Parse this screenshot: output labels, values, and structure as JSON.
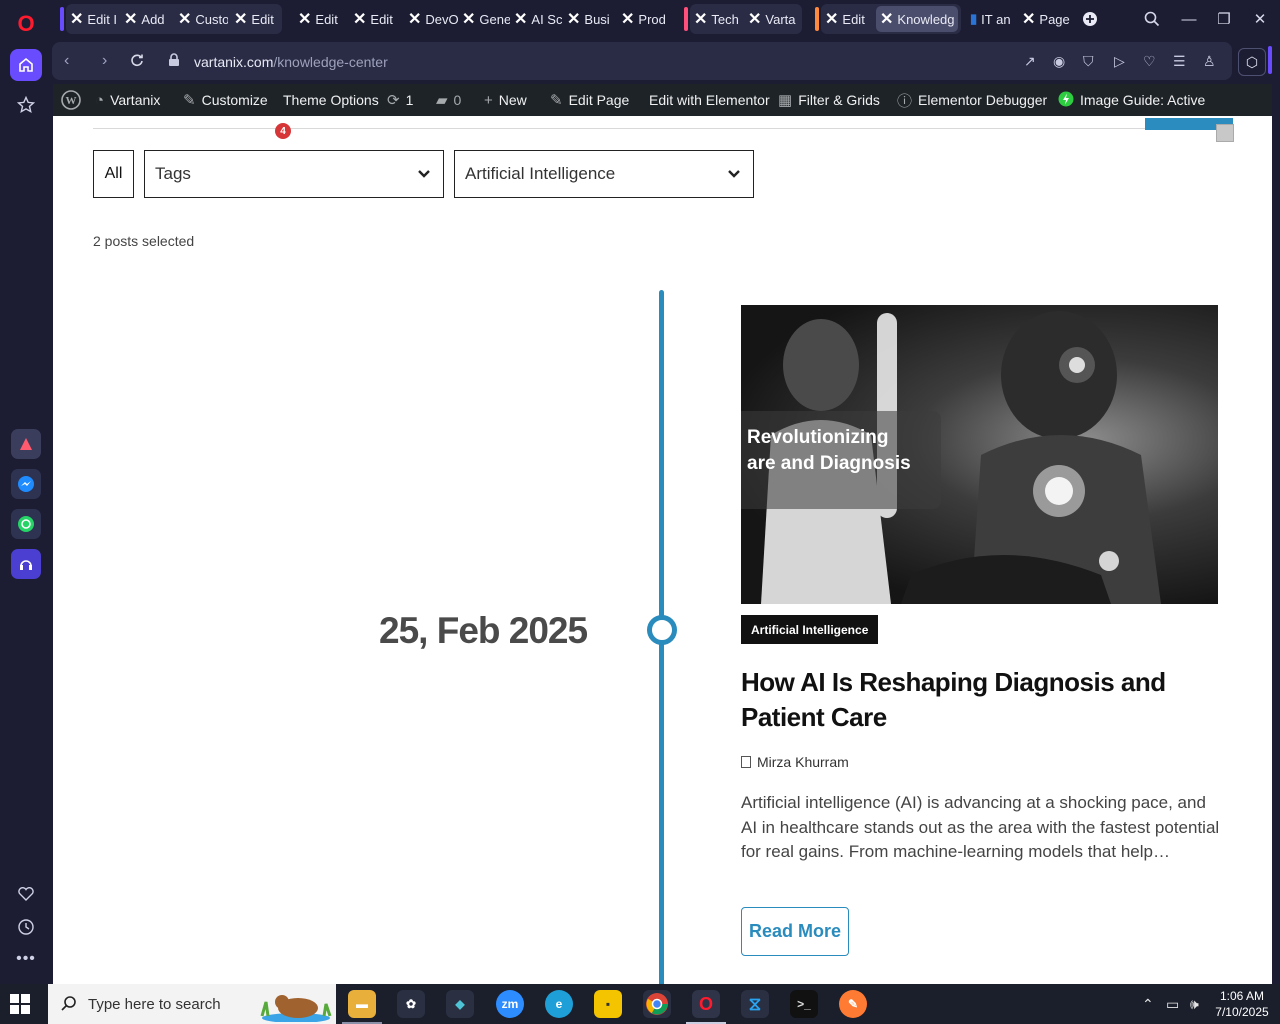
{
  "browser": {
    "tabs": [
      {
        "label": "Edit I"
      },
      {
        "label": "Add"
      },
      {
        "label": "Custo"
      },
      {
        "label": "Edit"
      },
      {
        "label": "Edit"
      },
      {
        "label": "Edit"
      },
      {
        "label": "DevO"
      },
      {
        "label": "Gene"
      },
      {
        "label": "AI Sc"
      },
      {
        "label": "Busi"
      },
      {
        "label": "Prod"
      },
      {
        "label": "Tech"
      },
      {
        "label": "Varta"
      },
      {
        "label": "Edit"
      },
      {
        "label": "Knowledg"
      },
      {
        "label": "IT an"
      },
      {
        "label": "Page"
      }
    ],
    "new_tab_icon": "plus-icon",
    "url_host": "vartanix.com",
    "url_path": "/knowledge-center",
    "group_colors": {
      "purple": "#6a4cff",
      "pink": "#ff4f7a",
      "orange": "#ff8a3d"
    }
  },
  "wpbar": {
    "site_name": "Vartanix",
    "customize": "Customize",
    "theme_options": "Theme Options",
    "updates_count": "1",
    "comments_count": "0",
    "new": "New",
    "edit_page": "Edit Page",
    "edit_elementor": "Edit with Elementor",
    "filter_grids": "Filter & Grids",
    "elementor_debugger": "Elementor Debugger",
    "image_guide": "Image Guide: Active"
  },
  "page": {
    "notification_count": "4",
    "filters": {
      "all_label": "All",
      "tags_placeholder": "Tags",
      "category_selected": "Artificial Intelligence"
    },
    "posts_selected": "2 posts selected",
    "post": {
      "date": "25, Feb 2025",
      "image_caption": "Revolutionizing\nare and Diagnosis",
      "category": "Artificial Intelligence",
      "title": "How AI Is Reshaping Diagnosis and Patient Care",
      "author": "Mirza Khurram",
      "excerpt": "Artificial intelligence (AI) is advancing at a shocking pace, and AI in healthcare stands out as the area with the fastest potential for real gains. From machine-learning models that help…",
      "read_more": "Read More"
    },
    "accent_color": "#2a8bbd"
  },
  "taskbar": {
    "search_placeholder": "Type here to search",
    "time": "1:06 AM",
    "date": "7/10/2025"
  }
}
